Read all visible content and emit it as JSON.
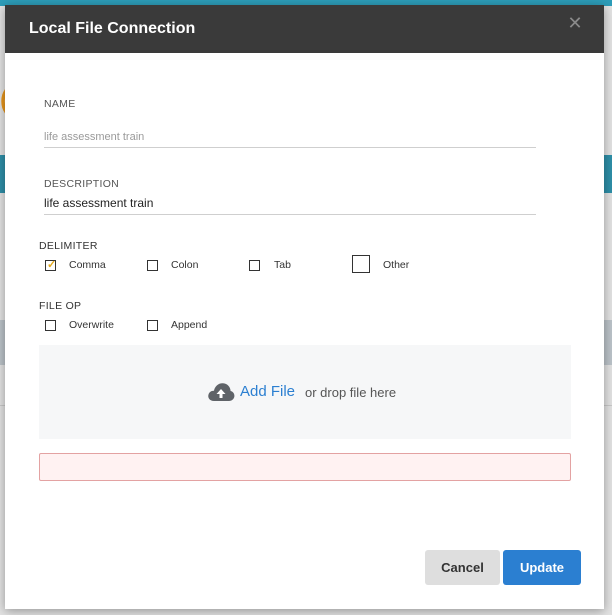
{
  "dialog": {
    "title": "Local File Connection",
    "close_icon": "close-icon"
  },
  "form": {
    "name_label": "NAME",
    "name_placeholder": "life assessment train",
    "name_value": "",
    "description_label": "DESCRIPTION",
    "description_value": "life assessment train",
    "delimiter_label": "DELIMITER",
    "delimiter_options": [
      {
        "label": "Comma",
        "checked": true
      },
      {
        "label": "Colon",
        "checked": false
      },
      {
        "label": "Tab",
        "checked": false
      },
      {
        "label": "Other",
        "checked": false
      }
    ],
    "fileop_label": "FILE OP",
    "fileop_options": [
      {
        "label": "Overwrite",
        "checked": false
      },
      {
        "label": "Append",
        "checked": false
      }
    ]
  },
  "dropzone": {
    "icon": "cloud-upload-icon",
    "add_file_label": "Add File",
    "hint": "or drop file here"
  },
  "buttons": {
    "cancel_label": "Cancel",
    "update_label": "Update"
  },
  "colors": {
    "header_bg": "#3a3a3a",
    "accent": "#2b7fd1",
    "check": "#e4a91a"
  }
}
